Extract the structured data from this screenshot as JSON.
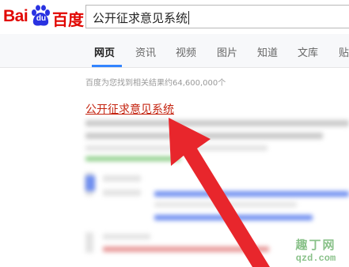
{
  "logo": {
    "bai": "Bai",
    "du": "du",
    "chinese": "百度"
  },
  "search": {
    "query": "公开征求意见系统"
  },
  "tabs": [
    {
      "label": "网页",
      "active": true
    },
    {
      "label": "资讯",
      "active": false
    },
    {
      "label": "视频",
      "active": false
    },
    {
      "label": "图片",
      "active": false
    },
    {
      "label": "知道",
      "active": false
    },
    {
      "label": "文库",
      "active": false
    },
    {
      "label": "贴",
      "active": false
    }
  ],
  "results": {
    "count_text": "百度为您找到相关结果约64,600,000个",
    "first_title": "公开征求意见系统"
  },
  "watermark": {
    "top": "趣丁网",
    "bottom": "qzd.com"
  },
  "colors": {
    "brand_red": "#e10601",
    "brand_blue": "#2932e1",
    "link_red": "#c4230f",
    "accent_blue": "#3385ff",
    "arrow_red": "#e8262c"
  }
}
